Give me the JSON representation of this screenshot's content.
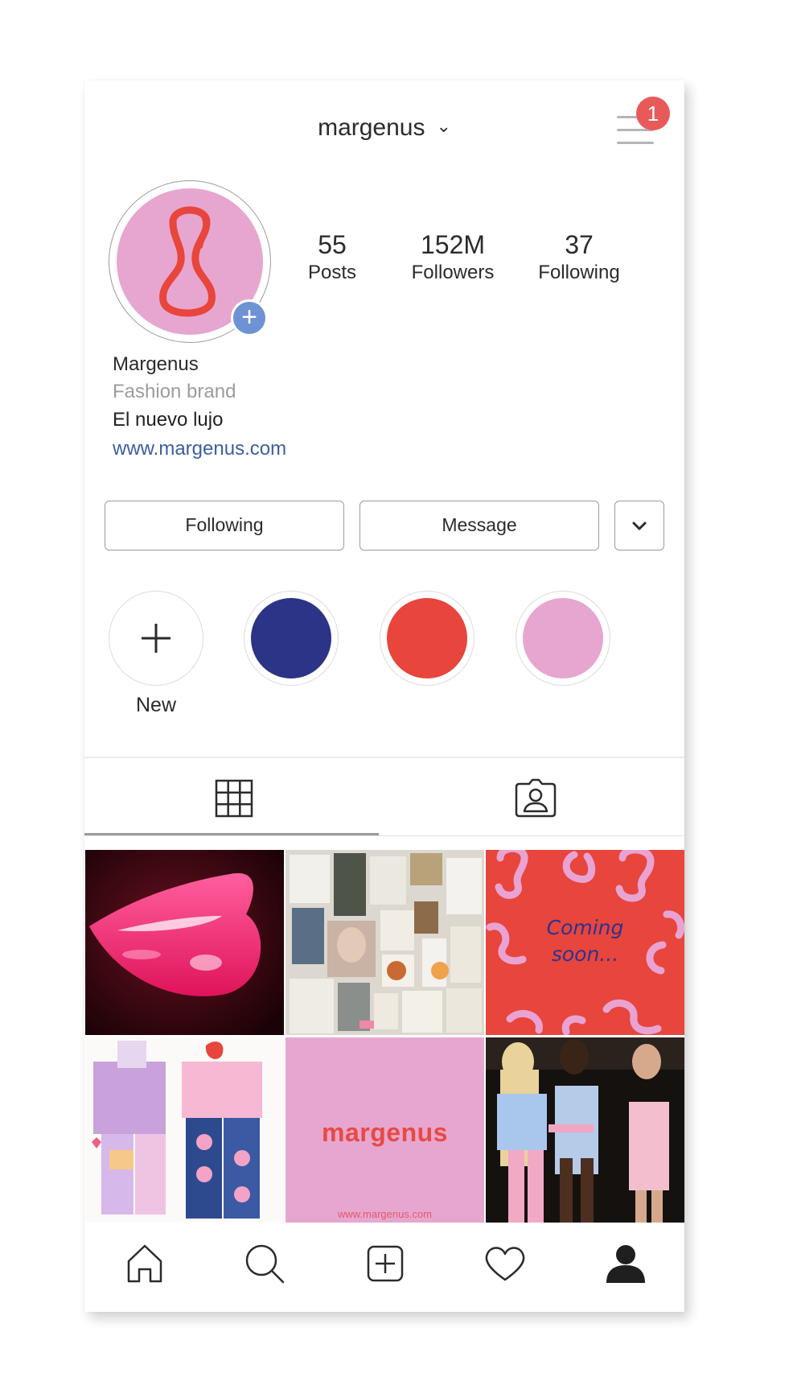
{
  "header": {
    "username": "margenus",
    "notifications_count": "1"
  },
  "profile": {
    "stats": [
      {
        "value": "55",
        "label": "Posts"
      },
      {
        "value": "152M",
        "label": "Followers"
      },
      {
        "value": "37",
        "label": "Following"
      }
    ],
    "name": "Margenus",
    "category": "Fashion brand",
    "bio": "El nuevo lujo",
    "website": "www.margenus.com"
  },
  "actions": {
    "following_label": "Following",
    "message_label": "Message"
  },
  "highlights": {
    "new_label": "New",
    "colors": [
      "#2b3486",
      "#e8453c",
      "#e7a6cf"
    ]
  },
  "tabs": [
    {
      "icon": "grid-icon",
      "active": true
    },
    {
      "icon": "tagged-person-icon",
      "active": false
    }
  ],
  "posts": [
    {
      "kind": "photo",
      "subject": "lips"
    },
    {
      "kind": "photo",
      "subject": "moodboard"
    },
    {
      "kind": "graphic",
      "text_line1": "Coming",
      "text_line2": "soon..."
    },
    {
      "kind": "illustration",
      "subject": "fashion-sketch"
    },
    {
      "kind": "graphic",
      "brand_text": "margenus",
      "url_text": "www.margenus.com"
    },
    {
      "kind": "photo",
      "subject": "runway-models"
    }
  ],
  "bottom_nav": [
    "home-icon",
    "search-icon",
    "add-post-icon",
    "heart-icon",
    "profile-icon"
  ],
  "colors": {
    "accent_blue": "#6e93d4",
    "link_blue": "#3b5f9f",
    "badge_red": "#e85a5a",
    "brand_pink": "#e7a6cf",
    "brand_red": "#e8453c",
    "brand_navy": "#2b3486"
  }
}
